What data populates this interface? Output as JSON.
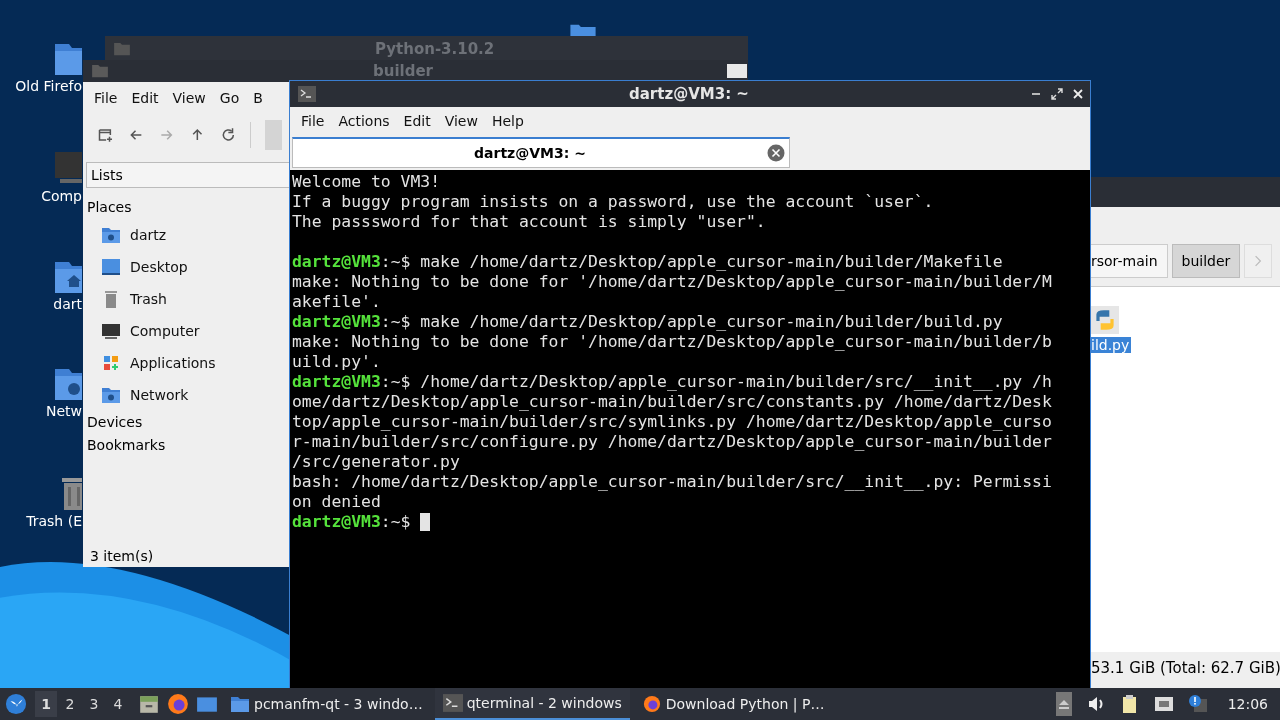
{
  "desktop_icons": [
    {
      "kind": "folder",
      "label": "Old Firefo"
    },
    {
      "kind": "computer",
      "label": "Comp"
    },
    {
      "kind": "home",
      "label": "dart"
    },
    {
      "kind": "network",
      "label": "Netw"
    },
    {
      "kind": "trash",
      "label": "Trash (E"
    }
  ],
  "python_window": {
    "title": "Python-3.10.2"
  },
  "file_manager": {
    "title": "builder",
    "menu": [
      "File",
      "Edit",
      "View",
      "Go",
      "B"
    ],
    "pane_selector": "Lists",
    "sections": [
      {
        "label": "Places",
        "items": [
          {
            "kind": "home",
            "label": "dartz"
          },
          {
            "kind": "desktop",
            "label": "Desktop"
          },
          {
            "kind": "trash",
            "label": "Trash"
          },
          {
            "kind": "computer",
            "label": "Computer"
          },
          {
            "kind": "applications",
            "label": "Applications"
          },
          {
            "kind": "network",
            "label": "Network"
          }
        ]
      },
      {
        "label": "Devices"
      },
      {
        "label": "Bookmarks"
      }
    ],
    "status": "3 item(s)"
  },
  "terminal": {
    "title": "dartz@VM3: ~",
    "menu": [
      "File",
      "Actions",
      "Edit",
      "View",
      "Help"
    ],
    "tabs": [
      {
        "label": "dartz@VM3: ~",
        "selected": true
      }
    ],
    "lines": [
      {
        "kind": "output",
        "text": "Welcome to VM3!"
      },
      {
        "kind": "output",
        "text": "If a buggy program insists on a password, use the account `user`."
      },
      {
        "kind": "output",
        "text": "The passsword for that account is simply \"user\"."
      },
      {
        "kind": "blank"
      },
      {
        "kind": "prompt",
        "user": "dartz@VM3",
        "text": ":~$ make /home/dartz/Desktop/apple_cursor-main/builder/Makefile"
      },
      {
        "kind": "output",
        "text": "make: Nothing to be done for '/home/dartz/Desktop/apple_cursor-main/builder/M"
      },
      {
        "kind": "output",
        "text": "akefile'."
      },
      {
        "kind": "prompt",
        "user": "dartz@VM3",
        "text": ":~$ make /home/dartz/Desktop/apple_cursor-main/builder/build.py"
      },
      {
        "kind": "output",
        "text": "make: Nothing to be done for '/home/dartz/Desktop/apple_cursor-main/builder/b"
      },
      {
        "kind": "output",
        "text": "uild.py'."
      },
      {
        "kind": "prompt",
        "user": "dartz@VM3",
        "text": ":~$ /home/dartz/Desktop/apple_cursor-main/builder/src/__init__.py /h"
      },
      {
        "kind": "output",
        "text": "ome/dartz/Desktop/apple_cursor-main/builder/src/constants.py /home/dartz/Desk"
      },
      {
        "kind": "output",
        "text": "top/apple_cursor-main/builder/src/symlinks.py /home/dartz/Desktop/apple_curso"
      },
      {
        "kind": "output",
        "text": "r-main/builder/src/configure.py /home/dartz/Desktop/apple_cursor-main/builder"
      },
      {
        "kind": "output",
        "text": "/src/generator.py"
      },
      {
        "kind": "output",
        "text": "bash: /home/dartz/Desktop/apple_cursor-main/builder/src/__init__.py: Permissi"
      },
      {
        "kind": "output",
        "text": "on denied"
      },
      {
        "kind": "cursor",
        "user": "dartz@VM3",
        "text": ":~$ "
      }
    ]
  },
  "builder_window": {
    "crumbs": [
      {
        "label": "rsor-main",
        "selected": false
      },
      {
        "label": "builder",
        "selected": true
      }
    ],
    "files": [
      {
        "label": "ild.py",
        "selected": true
      }
    ],
    "status": "53.1 GiB (Total: 62.7 GiB)"
  },
  "taskbar": {
    "workspaces": [
      {
        "label": "1",
        "selected": true
      },
      {
        "label": "2",
        "selected": false
      },
      {
        "label": "3",
        "selected": false
      },
      {
        "label": "4",
        "selected": false
      }
    ],
    "tasks": [
      {
        "kind": "folder",
        "label": "pcmanfm-qt - 3 windo…",
        "selected": false
      },
      {
        "kind": "terminal",
        "label": "qterminal - 2 windows",
        "selected": true
      },
      {
        "kind": "firefox",
        "label": "Download Python | P…",
        "selected": false
      }
    ],
    "clock": "12:06"
  }
}
